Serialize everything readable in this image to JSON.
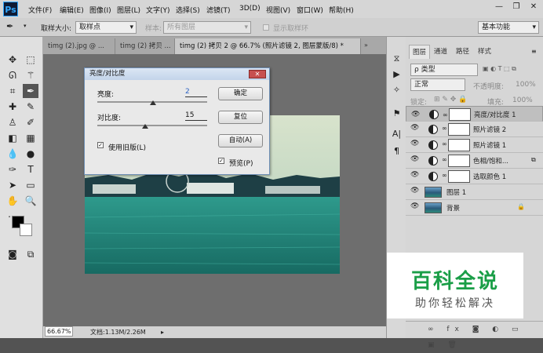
{
  "app": {
    "logo": "Ps"
  },
  "menu": [
    "文件(F)",
    "编辑(E)",
    "图像(I)",
    "图层(L)",
    "文字(Y)",
    "选择(S)",
    "滤镜(T)",
    "3D(D)",
    "视图(V)",
    "窗口(W)",
    "帮助(H)"
  ],
  "options": {
    "sample_size_label": "取样大小:",
    "sample_size_value": "取样点",
    "sample_label": "样本:",
    "sample_value": "所有图层",
    "show_ring_label": "显示取样环",
    "workspace": "基本功能"
  },
  "tabs": [
    {
      "label": "timg (2).jpg @ ..."
    },
    {
      "label": "timg (2) 拷贝 ..."
    },
    {
      "label": "timg (2) 拷贝 2 @ 66.7% (照片滤镜 2, 图层蒙版/8) *"
    }
  ],
  "status": {
    "zoom": "66.67%",
    "doc": "文档:1.13M/2.26M"
  },
  "dialog": {
    "title": "亮度/对比度",
    "brightness_label": "亮度:",
    "brightness_value": "2",
    "contrast_label": "对比度:",
    "contrast_value": "15",
    "brightness_level": 2,
    "contrast_level": 15,
    "ok": "确定",
    "reset": "复位",
    "auto": "自动(A)",
    "legacy_label": "使用旧版(L)",
    "legacy_checked": true,
    "preview_label": "预览(P)",
    "preview_checked": true
  },
  "layers_panel": {
    "tabs": [
      "图层",
      "通道",
      "路径",
      "样式"
    ],
    "kind": "ρ 类型",
    "blend_mode": "正常",
    "opacity_label": "不透明度:",
    "opacity_value": "100%",
    "lock_label": "锁定:",
    "fill_label": "填充:",
    "fill_value": "100%",
    "layers": [
      {
        "name": "亮度/对比度 1"
      },
      {
        "name": "照片滤镜 2"
      },
      {
        "name": "照片滤镜 1"
      },
      {
        "name": "色相/饱和..."
      },
      {
        "name": "选取颜色 1"
      },
      {
        "name": "图层 1"
      },
      {
        "name": "背景"
      }
    ]
  },
  "watermark": {
    "title": "百科全说",
    "subtitle": "助你轻松解决"
  }
}
